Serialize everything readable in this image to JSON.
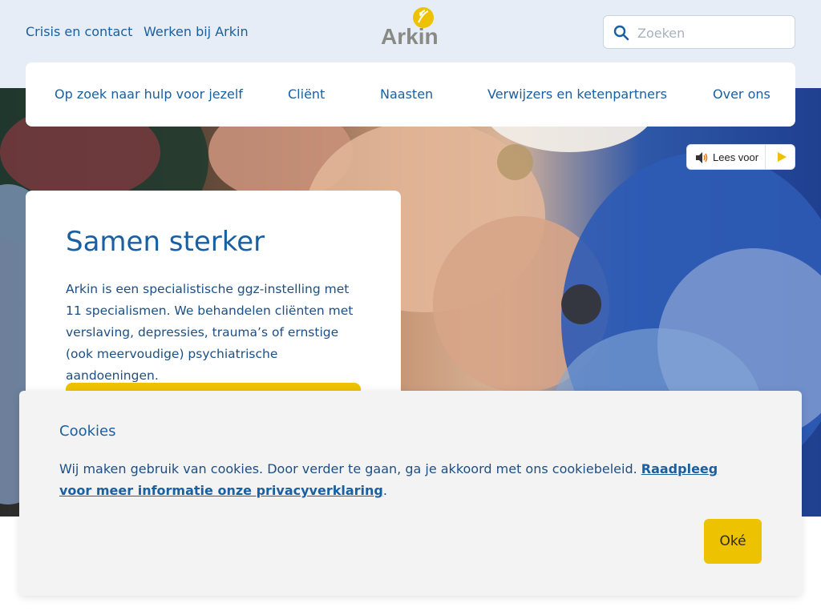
{
  "header": {
    "links": [
      {
        "label": "Crisis en contact"
      },
      {
        "label": "Werken bij Arkin"
      }
    ],
    "logo_text": "Arkin",
    "search": {
      "placeholder": "Zoeken",
      "value": ""
    }
  },
  "nav": {
    "items": [
      {
        "label": "Op zoek naar hulp voor jezelf"
      },
      {
        "label": "Cliënt"
      },
      {
        "label": "Naasten"
      },
      {
        "label": "Verwijzers en ketenpartners"
      },
      {
        "label": "Over ons"
      }
    ]
  },
  "readspeaker": {
    "label": "Lees voor"
  },
  "hero": {
    "title": "Samen sterker",
    "text": "Arkin is een specialistische ggz-instelling met 11 specialismen. We behandelen cliënten met verslaving, depressies, trauma’s of ernstige (ook meervoudige) psychiatrische aandoeningen."
  },
  "cookie": {
    "title": "Cookies",
    "text": "Wij maken gebruik van cookies. Door verder te gaan, ga je akkoord met ons cookiebeleid. ",
    "link_label": "Raadpleeg voor meer informatie onze privacyverklaring",
    "text_end": ".",
    "button_label": "Oké"
  },
  "colors": {
    "brand_blue": "#1a5fa0",
    "accent_yellow": "#edc200",
    "header_bg": "#e6edf6",
    "cookie_bg": "#f3f3f4"
  },
  "icons": [
    "search-icon",
    "speaker-icon",
    "play-icon",
    "logo-icon"
  ]
}
